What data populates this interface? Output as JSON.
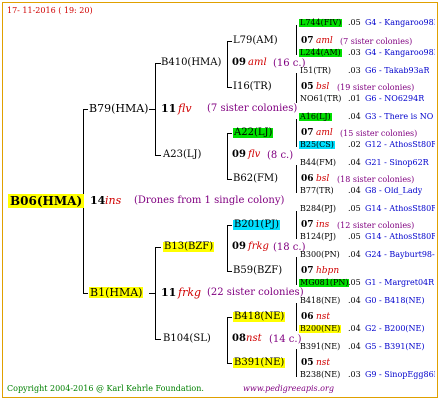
{
  "header": {
    "date": "17- 11-2016 ( 19: 20)"
  },
  "footer": {
    "copyright": "Copyright 2004-2016 @ Karl Kehrle Foundation.",
    "site": "www.pedigreeapis.org"
  },
  "root": {
    "name": "B06(HMA)",
    "year": "14",
    "ins": "ins",
    "note": "(Drones from 1 single colony)"
  },
  "g1": {
    "father": {
      "name": "B79(HMA)",
      "year": "11",
      "ins": "flv",
      "note": "(7 sister colonies)"
    },
    "mother": {
      "name": "B1(HMA)",
      "year": "11",
      "ins": "frkg",
      "note": "(22 sister colonies)"
    }
  },
  "g2": {
    "ff": {
      "name": "B410(HMA)",
      "year": "09",
      "ins": "aml",
      "note": "(16 c.)"
    },
    "fm": {
      "name": "A23(LJ)",
      "year": "09",
      "ins": "flv",
      "note": "(8 c.)"
    },
    "mf": {
      "name": "B13(BZF)",
      "year": "09",
      "ins": "frkg",
      "note": "(18 c.)"
    },
    "mm": {
      "name": "B104(SL)",
      "year": "08",
      "ins": "nst",
      "note": "(14 c.)"
    }
  },
  "g3": {
    "a": {
      "name": "L79(AM)",
      "year": "07",
      "ins": "aml",
      "note": "(7 sister colonies)"
    },
    "b": {
      "name": "I16(TR)",
      "year": "05",
      "ins": "bsl",
      "note": "(19 sister colonies)"
    },
    "c": {
      "name": "A22(LJ)",
      "year": "07",
      "ins": "aml",
      "note": "(15 sister colonies)"
    },
    "d": {
      "name": "B62(FM)",
      "year": "06",
      "ins": "bsl",
      "note": "(18 sister colonies)"
    },
    "e": {
      "name": "B201(PJ)",
      "year": "07",
      "ins": "ins",
      "note": "(12 sister colonies)"
    },
    "f": {
      "name": "B59(BZF)",
      "year": "07",
      "ins": "hbpn",
      "note": ""
    },
    "g": {
      "name": "B418(NE)",
      "year": "06",
      "ins": "nst",
      "note": ""
    },
    "h": {
      "name": "B391(NE)",
      "year": "05",
      "ins": "nst",
      "note": ""
    }
  },
  "g4": [
    {
      "name": "L744(FIV)",
      "year": ".05",
      "code": "G4 - Kangaroo98R"
    },
    {
      "name": "L244(AM)",
      "year": ".03",
      "code": "G4 - Kangaroo98R"
    },
    {
      "name": "I51(TR)",
      "year": ".03",
      "code": "G6 - Takab93aR"
    },
    {
      "name": "NO61(TR)",
      "year": ".01",
      "code": "G6 - NO6294R"
    },
    {
      "name": "A16(LJ)",
      "year": ".04",
      "code": "G3 - There is NO"
    },
    {
      "name": "B25(CS)",
      "year": ".02",
      "code": "G12 - AthosSt80R"
    },
    {
      "name": "B44(FM)",
      "year": ".04",
      "code": "G21 - Sinop62R"
    },
    {
      "name": "B77(TR)",
      "year": ".04",
      "code": "G8 - Old_Lady"
    },
    {
      "name": "B284(PJ)",
      "year": ".05",
      "code": "G14 - AthosSt80R"
    },
    {
      "name": "B124(PJ)",
      "year": ".05",
      "code": "G14 - AthosSt80R"
    },
    {
      "name": "B300(PN)",
      "year": ".04",
      "code": "G24 - Bayburt98-3"
    },
    {
      "name": "MG081(PN)",
      "year": ".05",
      "code": "G1 - Margret04R"
    },
    {
      "name": "B418(NE)",
      "year": ".04",
      "code": "G0 - B418(NE)"
    },
    {
      "name": "B200(NE)",
      "year": ".04",
      "code": "G2 - B200(NE)"
    },
    {
      "name": "B391(NE)",
      "year": ".04",
      "code": "G5 - B391(NE)"
    },
    {
      "name": "B238(NE)",
      "year": ".03",
      "code": "G9 - SinopEgg86R"
    }
  ]
}
